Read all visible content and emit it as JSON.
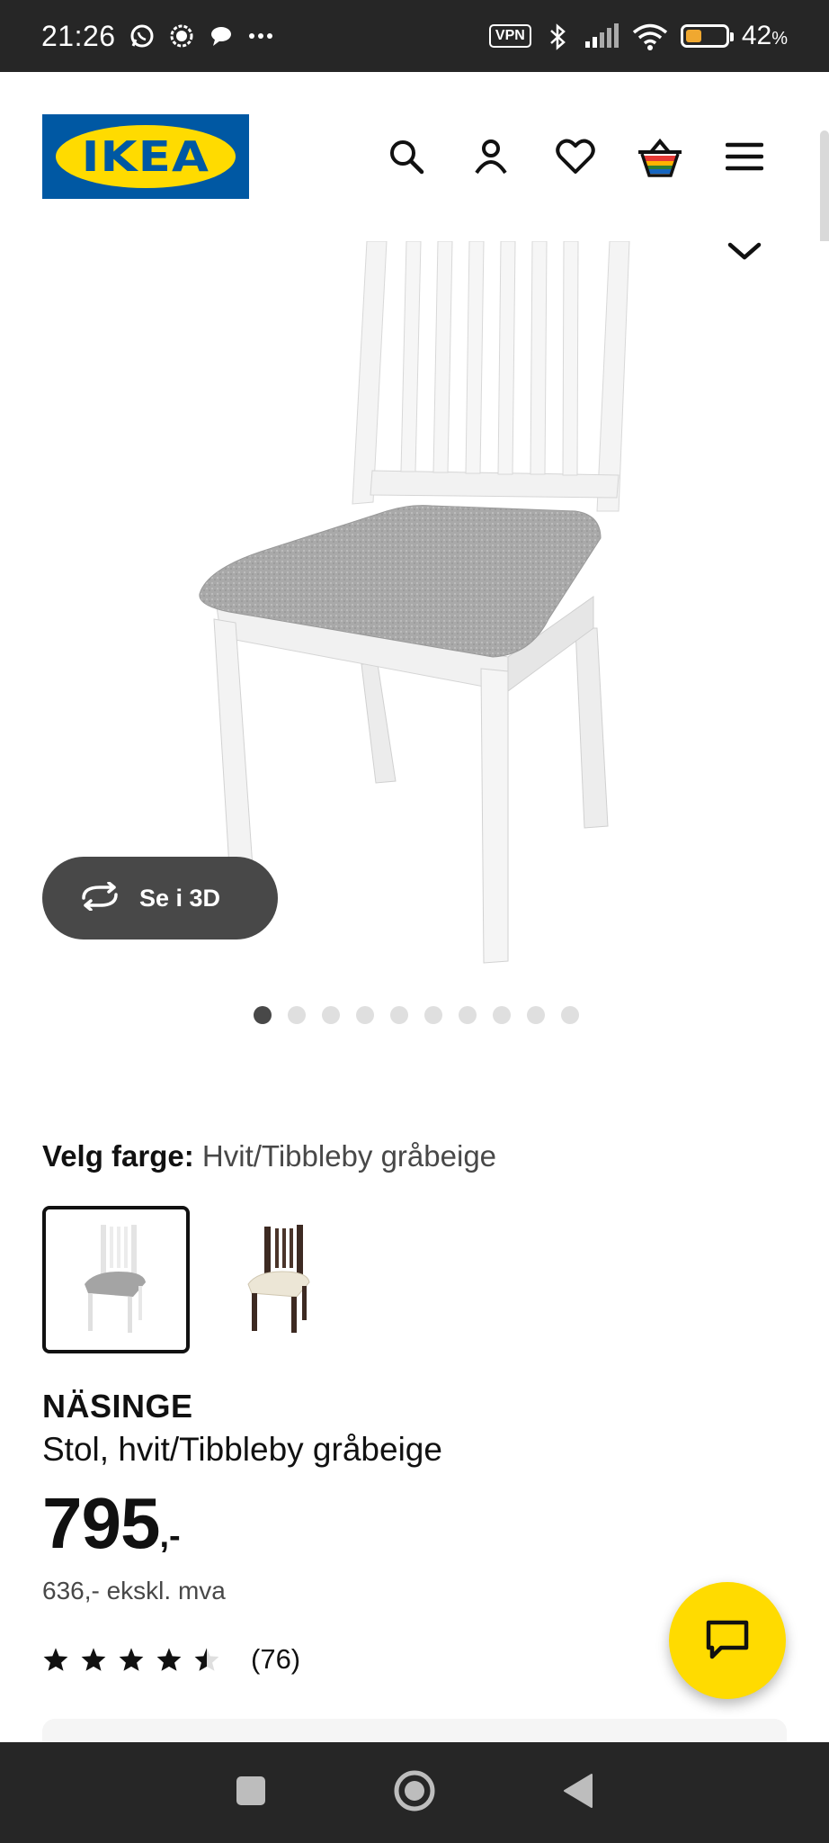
{
  "status_bar": {
    "time": "21:26",
    "vpn": "VPN",
    "battery_percent": "42",
    "battery_unit": "%",
    "icons": [
      "whatsapp-icon",
      "signal-app-icon",
      "chat-bubble-icon",
      "more-icon",
      "vpn-icon",
      "bluetooth-icon",
      "cell-signal-icon",
      "wifi-icon",
      "battery-icon"
    ]
  },
  "header": {
    "logo_text": "IKEA",
    "icons": [
      "search-icon",
      "account-icon",
      "wishlist-icon",
      "cart-icon",
      "menu-icon"
    ]
  },
  "gallery": {
    "button_3d_label": "Se i 3D",
    "dot_count": 10,
    "active_dot": 0
  },
  "color_picker": {
    "label": "Velg farge:",
    "selected_value": "Hvit/Tibbleby gråbeige"
  },
  "product": {
    "name": "NÄSINGE",
    "description": "Stol, hvit/Tibbleby gråbeige",
    "price_main": "795",
    "price_suffix": ",-",
    "price_ex_vat": "636,- ekskl. mva",
    "rating_value": 4.5,
    "rating_count": "(76)"
  },
  "colors": {
    "brand_blue": "#0058a3",
    "brand_yellow": "#ffdb00",
    "dark": "#111111",
    "status_bar_bg": "#262626"
  }
}
